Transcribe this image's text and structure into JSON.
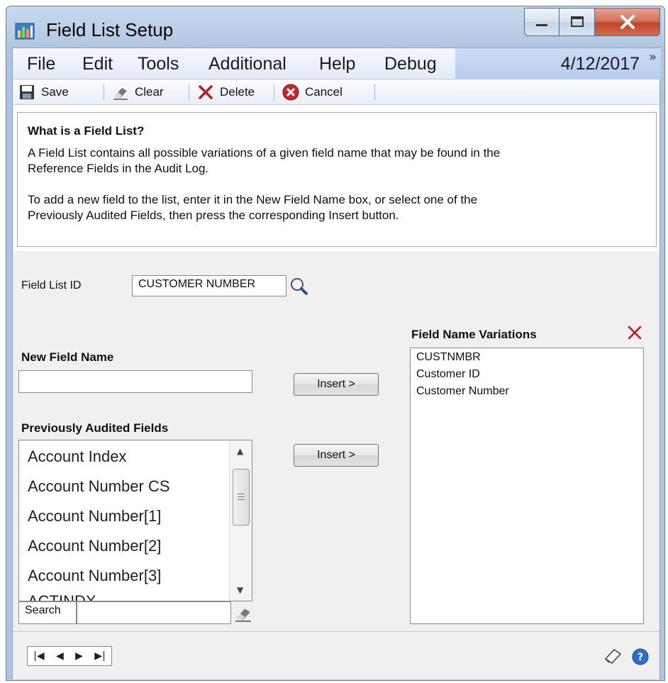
{
  "window": {
    "title": "Field List Setup"
  },
  "menu": {
    "items": [
      "File",
      "Edit",
      "Tools",
      "Additional",
      "Help",
      "Debug"
    ],
    "date": "4/12/2017"
  },
  "toolbar": {
    "save": "Save",
    "clear": "Clear",
    "delete": "Delete",
    "cancel": "Cancel"
  },
  "info": {
    "title": "What is a Field List?",
    "p1_line1": "A Field List contains all possible variations of a given field name that may be found in the",
    "p1_line2": "Reference Fields in the Audit Log.",
    "p2_line1": "To add a new field to the list, enter it in the New Field Name box, or select one of the",
    "p2_line2": "Previously Audited Fields, then press the corresponding Insert button."
  },
  "form": {
    "field_list_id_label": "Field List ID",
    "field_list_id_value": "CUSTOMER NUMBER",
    "new_field_label": "New Field Name",
    "new_field_value": "",
    "insert_label": "Insert >",
    "prev_label": "Previously Audited Fields",
    "prev_items": [
      "Account Index",
      "Account Number CS",
      "Account Number[1]",
      "Account Number[2]",
      "Account Number[3]",
      "ACTINDX"
    ],
    "search_label": "Search",
    "search_value": "",
    "variations_label": "Field Name Variations",
    "variations": [
      "CUSTNMBR",
      "Customer ID",
      "Customer Number"
    ]
  },
  "colors": {
    "accent": "#b6cdef",
    "close": "#c0442a",
    "delete_x": "#c0392b"
  }
}
